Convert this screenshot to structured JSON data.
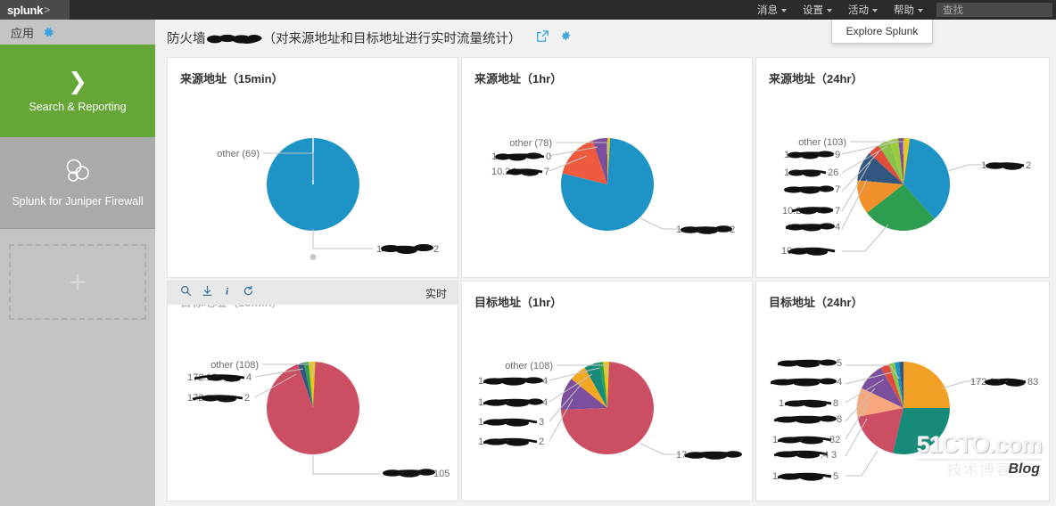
{
  "topbar": {
    "logo": "splunk",
    "logo_chevron": ">",
    "nav": [
      {
        "label": "消息",
        "icon": "chevron-down-icon"
      },
      {
        "label": "设置",
        "icon": "chevron-down-icon"
      },
      {
        "label": "活动",
        "icon": "chevron-down-icon"
      },
      {
        "label": "帮助",
        "icon": "chevron-down-icon"
      }
    ],
    "search_placeholder": "查找",
    "search_value": ""
  },
  "dropdown": {
    "item": "Explore Splunk"
  },
  "sidebar": {
    "apps_label": "应用",
    "gear_icon": "gear-icon",
    "tiles": [
      {
        "label": "Search & Reporting",
        "icon": "chevron-right-icon",
        "active": true
      },
      {
        "label": "Splunk for Juniper Firewall",
        "icon": "bubbles-icon",
        "active": false
      }
    ],
    "add_label": "+"
  },
  "header": {
    "title_prefix": "防火墙",
    "title_redacted": "[已遮盖]",
    "title_suffix": "（对来源地址和目标地址进行实时流量统计）",
    "icons": [
      "external-link-icon",
      "gear-icon"
    ]
  },
  "panel_toolbar": {
    "icons": [
      "search-icon",
      "download-icon",
      "info-icon",
      "refresh-icon"
    ],
    "realtime_label": "实时"
  },
  "watermark": {
    "top": "51CTO.com",
    "bottom": "技术博客",
    "blog": "Blog"
  },
  "chart_data": [
    {
      "type": "pie",
      "title": "来源地址（15min）",
      "panel_index": 0,
      "legend": "none",
      "labels": [
        "other (69)",
        "1▓▓.▓▓.▓▓.▓▓2"
      ],
      "values": [
        2,
        98
      ],
      "colors": [
        "#9e9e9e",
        "#1e93c6"
      ],
      "callouts": [
        {
          "text": "other (69)",
          "side": "left"
        },
        {
          "text": "1▓▓.▓▓▓▓▓▓.▓2",
          "side": "right"
        }
      ]
    },
    {
      "type": "pie",
      "title": "来源地址（1hr）",
      "panel_index": 1,
      "legend": "none",
      "labels": [
        "other (78)",
        "1▓.▓▓▓▓▓▓▓0",
        "10.24▓▓▓▓▓7",
        "1▓.24▓▓▓▓2"
      ],
      "values": [
        1.5,
        3.5,
        13,
        82
      ],
      "colors": [
        "#e8c51e",
        "#7b4f9d",
        "#ed5a3d",
        "#1e93c6"
      ],
      "callouts": [
        {
          "text": "other (78)",
          "side": "left"
        },
        {
          "text": "1▓▓▓▓▓▓▓▓0",
          "side": "left"
        },
        {
          "text": "10.24▓▓▓▓7",
          "side": "left"
        },
        {
          "text": "1▓.24▓▓▓▓2",
          "side": "right"
        }
      ]
    },
    {
      "type": "pie",
      "title": "来源地址（24hr）",
      "panel_index": 2,
      "legend": "none",
      "labels": [
        "other (103)",
        "1▓▓▓▓▓▓▓▓9",
        "1▓▓▓▓▓▓▓26",
        "▓▓▓▓▓▓▓▓7",
        "10.24▓▓▓▓7",
        "▓▓▓▓▓▓▓▓4",
        "10▓▓▓▓▓▓▓",
        "1▓▓2.1▓▓▓▓2"
      ],
      "values": [
        1.5,
        1.5,
        2,
        4,
        4,
        10,
        24,
        38
      ],
      "colors": [
        "#e8c51e",
        "#7b4f9d",
        "#8bc34a",
        "#9ccc3c",
        "#e04c3c",
        "#31567f",
        "#f2902c",
        "#2d9e4f"
      ],
      "callouts": [
        {
          "text": "other (103)",
          "side": "left"
        },
        {
          "text": "1▓▓▓▓▓▓▓▓9",
          "side": "left"
        },
        {
          "text": "1▓▓▓▓▓▓▓26",
          "side": "left"
        },
        {
          "text": "▓▓▓▓▓▓▓▓▓7",
          "side": "left"
        },
        {
          "text": "10.24▓▓▓▓7",
          "side": "left"
        },
        {
          "text": "▓▓▓▓▓▓▓▓▓4",
          "side": "left"
        },
        {
          "text": "10▓▓▓▓▓▓▓",
          "side": "left"
        },
        {
          "text": "1▓▓2.1▓▓▓▓2",
          "side": "right"
        }
      ]
    },
    {
      "type": "pie",
      "title": "目标地址（15min）",
      "panel_index": 3,
      "legend": "none",
      "labels": [
        "other (108)",
        "172.10▓▓▓▓4",
        "172▓▓▓▓▓▓2",
        "▓▓▓▓▓▓▓▓105"
      ],
      "values": [
        1.5,
        1.5,
        2,
        95
      ],
      "colors": [
        "#e8c51e",
        "#2d9e4f",
        "#31567f",
        "#cc4e63"
      ],
      "callouts": [
        {
          "text": "other (108)",
          "side": "left"
        },
        {
          "text": "172.10▓▓▓▓4",
          "side": "left"
        },
        {
          "text": "172▓▓▓▓▓▓2",
          "side": "left"
        },
        {
          "text": "▓▓▓▓▓▓▓▓105",
          "side": "right"
        }
      ]
    },
    {
      "type": "pie",
      "title": "目标地址（1hr）",
      "panel_index": 4,
      "legend": "none",
      "labels": [
        "other (108)",
        "1▓▓▓▓▓▓▓▓4",
        "1▓▓▓▓▓▓▓▓4",
        "1▓▓▓▓▓▓▓3",
        "1▓▓▓▓▓▓▓2",
        "17▓▓▓▓▓▓▓"
      ],
      "values": [
        1,
        1.5,
        5,
        6,
        12,
        74
      ],
      "colors": [
        "#e8c51e",
        "#2d9e4f",
        "#178b7a",
        "#f5a623",
        "#7b4f9d",
        "#cc4e63"
      ],
      "callouts": [
        {
          "text": "other (108)",
          "side": "left"
        },
        {
          "text": "1▓▓▓▓▓▓▓▓4",
          "side": "left"
        },
        {
          "text": "1▓▓▓▓▓▓▓▓4",
          "side": "left"
        },
        {
          "text": "1▓▓▓▓▓▓▓3",
          "side": "left"
        },
        {
          "text": "1▓▓▓▓▓▓▓2",
          "side": "left"
        },
        {
          "text": "17▓▓▓▓▓▓▓",
          "side": "right"
        }
      ]
    },
    {
      "type": "pie",
      "title": "目标地址（24hr）",
      "panel_index": 5,
      "legend": "none",
      "labels": [
        "▓▓▓▓▓▓▓▓5",
        "▓▓▓▓▓▓▓▓4",
        "1▓▓▓▓▓▓▓8",
        "▓▓▓▓▓▓▓▓8",
        "1▓▓▓▓▓▓82",
        "▓▓▓▓9.4▓3",
        "1▓▓▓▓▓▓▓5",
        "172.1▓▓▓▓83"
      ],
      "values": [
        1.5,
        1.5,
        2,
        3,
        10,
        12,
        18,
        20,
        25
      ],
      "colors": [
        "#31567f",
        "#1e93c6",
        "#8bc34a",
        "#e04c3c",
        "#7b4f9d",
        "#f9a77c",
        "#cc4e63",
        "#178b7a",
        "#f2a025"
      ],
      "callouts": [
        {
          "text": "▓▓▓▓▓▓▓▓5",
          "side": "left"
        },
        {
          "text": "▓▓▓▓▓▓▓▓4",
          "side": "left"
        },
        {
          "text": "1▓▓▓▓▓▓▓8",
          "side": "left"
        },
        {
          "text": "▓▓▓▓▓▓▓▓8",
          "side": "left"
        },
        {
          "text": "1▓▓▓▓▓▓82",
          "side": "left"
        },
        {
          "text": "▓▓▓▓9.4▓3",
          "side": "left"
        },
        {
          "text": "1▓▓▓▓▓▓▓5",
          "side": "left"
        },
        {
          "text": "172.1▓▓▓▓83",
          "side": "right"
        }
      ]
    }
  ]
}
